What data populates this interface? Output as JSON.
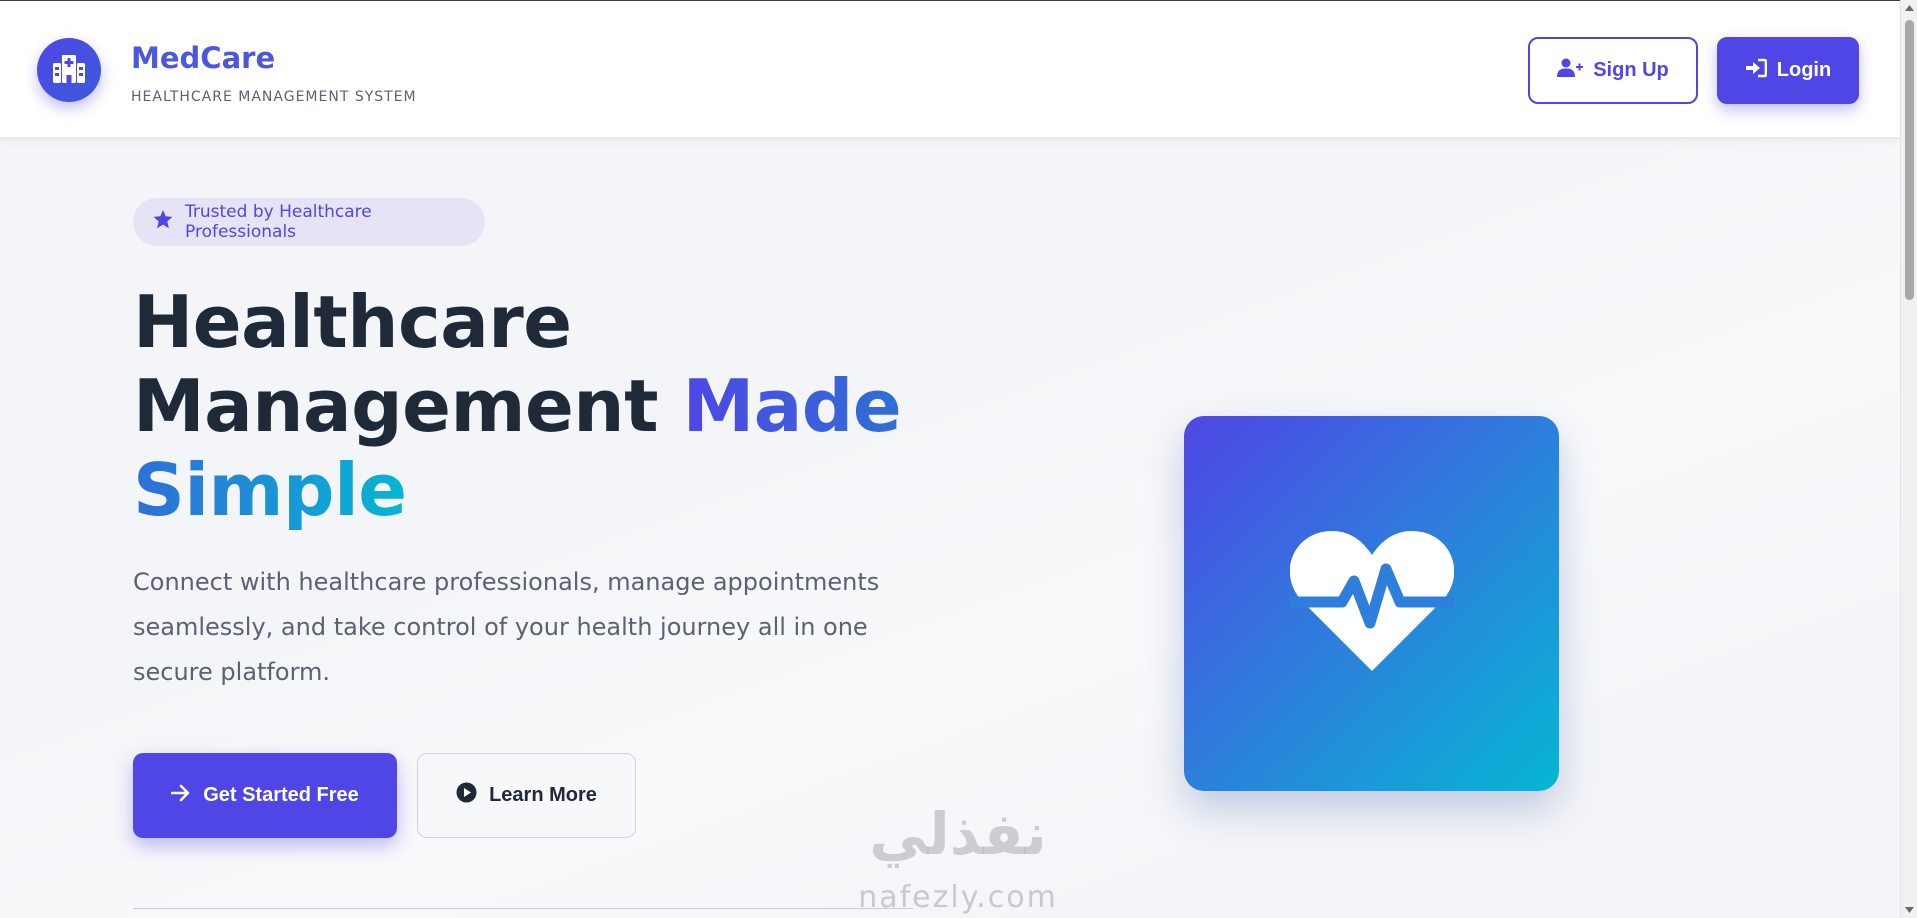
{
  "header": {
    "brand_name": "MedCare",
    "brand_subtitle": "HEALTHCARE MANAGEMENT SYSTEM",
    "logo_icon": "hospital-icon",
    "signup_label": "Sign Up",
    "signup_icon": "user-plus-icon",
    "login_label": "Login",
    "login_icon": "sign-in-icon"
  },
  "hero": {
    "badge_text": "Trusted by Healthcare Professionals",
    "badge_icon": "star-icon",
    "title_line1": "Healthcare",
    "title_line2": "Management",
    "title_accent1": "Made",
    "title_accent2": "Simple",
    "description": "Connect with healthcare professionals, manage appointments seamlessly, and take control of your health journey all in one secure platform.",
    "primary_button": "Get Started Free",
    "primary_icon": "arrow-right-icon",
    "secondary_button": "Learn More",
    "secondary_icon": "play-circle-icon",
    "card_icon": "heart-pulse-icon"
  },
  "watermark": {
    "arabic": "نفذلي",
    "latin": "nafezly.com"
  },
  "colors": {
    "primary": "#4f46e5",
    "accent_blue": "#2f6fd6",
    "accent_cyan": "#06b6d4",
    "text_dark": "#1f2937",
    "text_muted": "#5b6270",
    "background": "#f3f5f8"
  }
}
